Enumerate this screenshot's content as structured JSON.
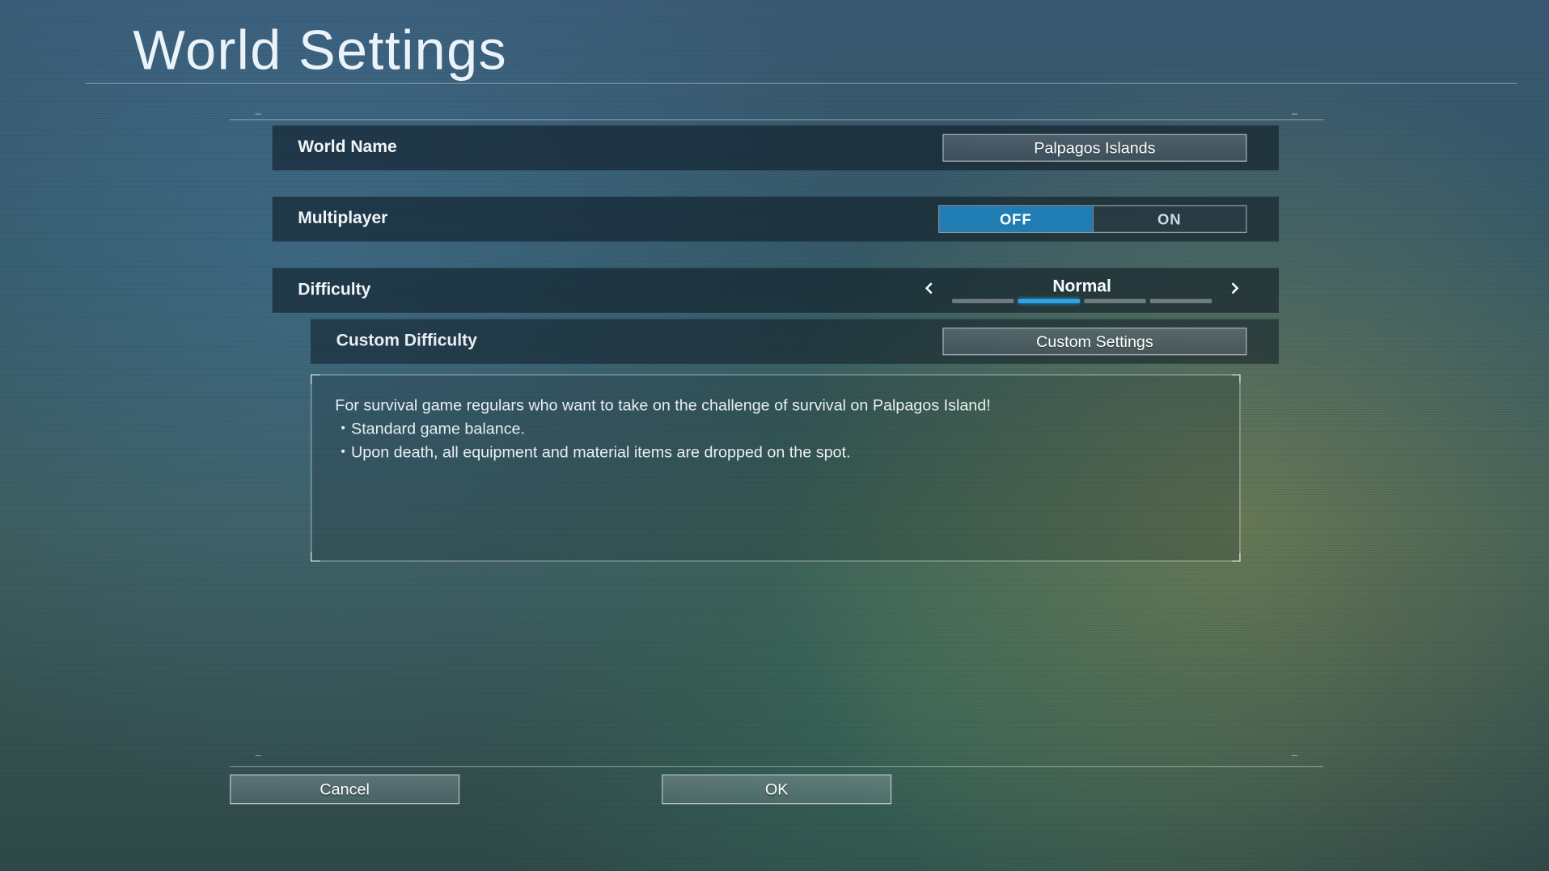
{
  "title": "World Settings",
  "rows": {
    "world_name": {
      "label": "World Name",
      "value": "Palpagos Islands"
    },
    "multiplayer": {
      "label": "Multiplayer",
      "off": "OFF",
      "on": "ON",
      "selected": "OFF"
    },
    "difficulty": {
      "label": "Difficulty",
      "value": "Normal",
      "segment_count": 4,
      "active_segment": 1
    },
    "custom": {
      "label": "Custom Difficulty",
      "button": "Custom Settings"
    }
  },
  "description": {
    "line1": "For survival game regulars who want to take on the challenge of survival on Palpagos Island!",
    "line2": "・Standard game balance.",
    "line3": "・Upon death, all equipment and material items are dropped on the spot."
  },
  "footer": {
    "cancel": "Cancel",
    "ok": "OK"
  }
}
